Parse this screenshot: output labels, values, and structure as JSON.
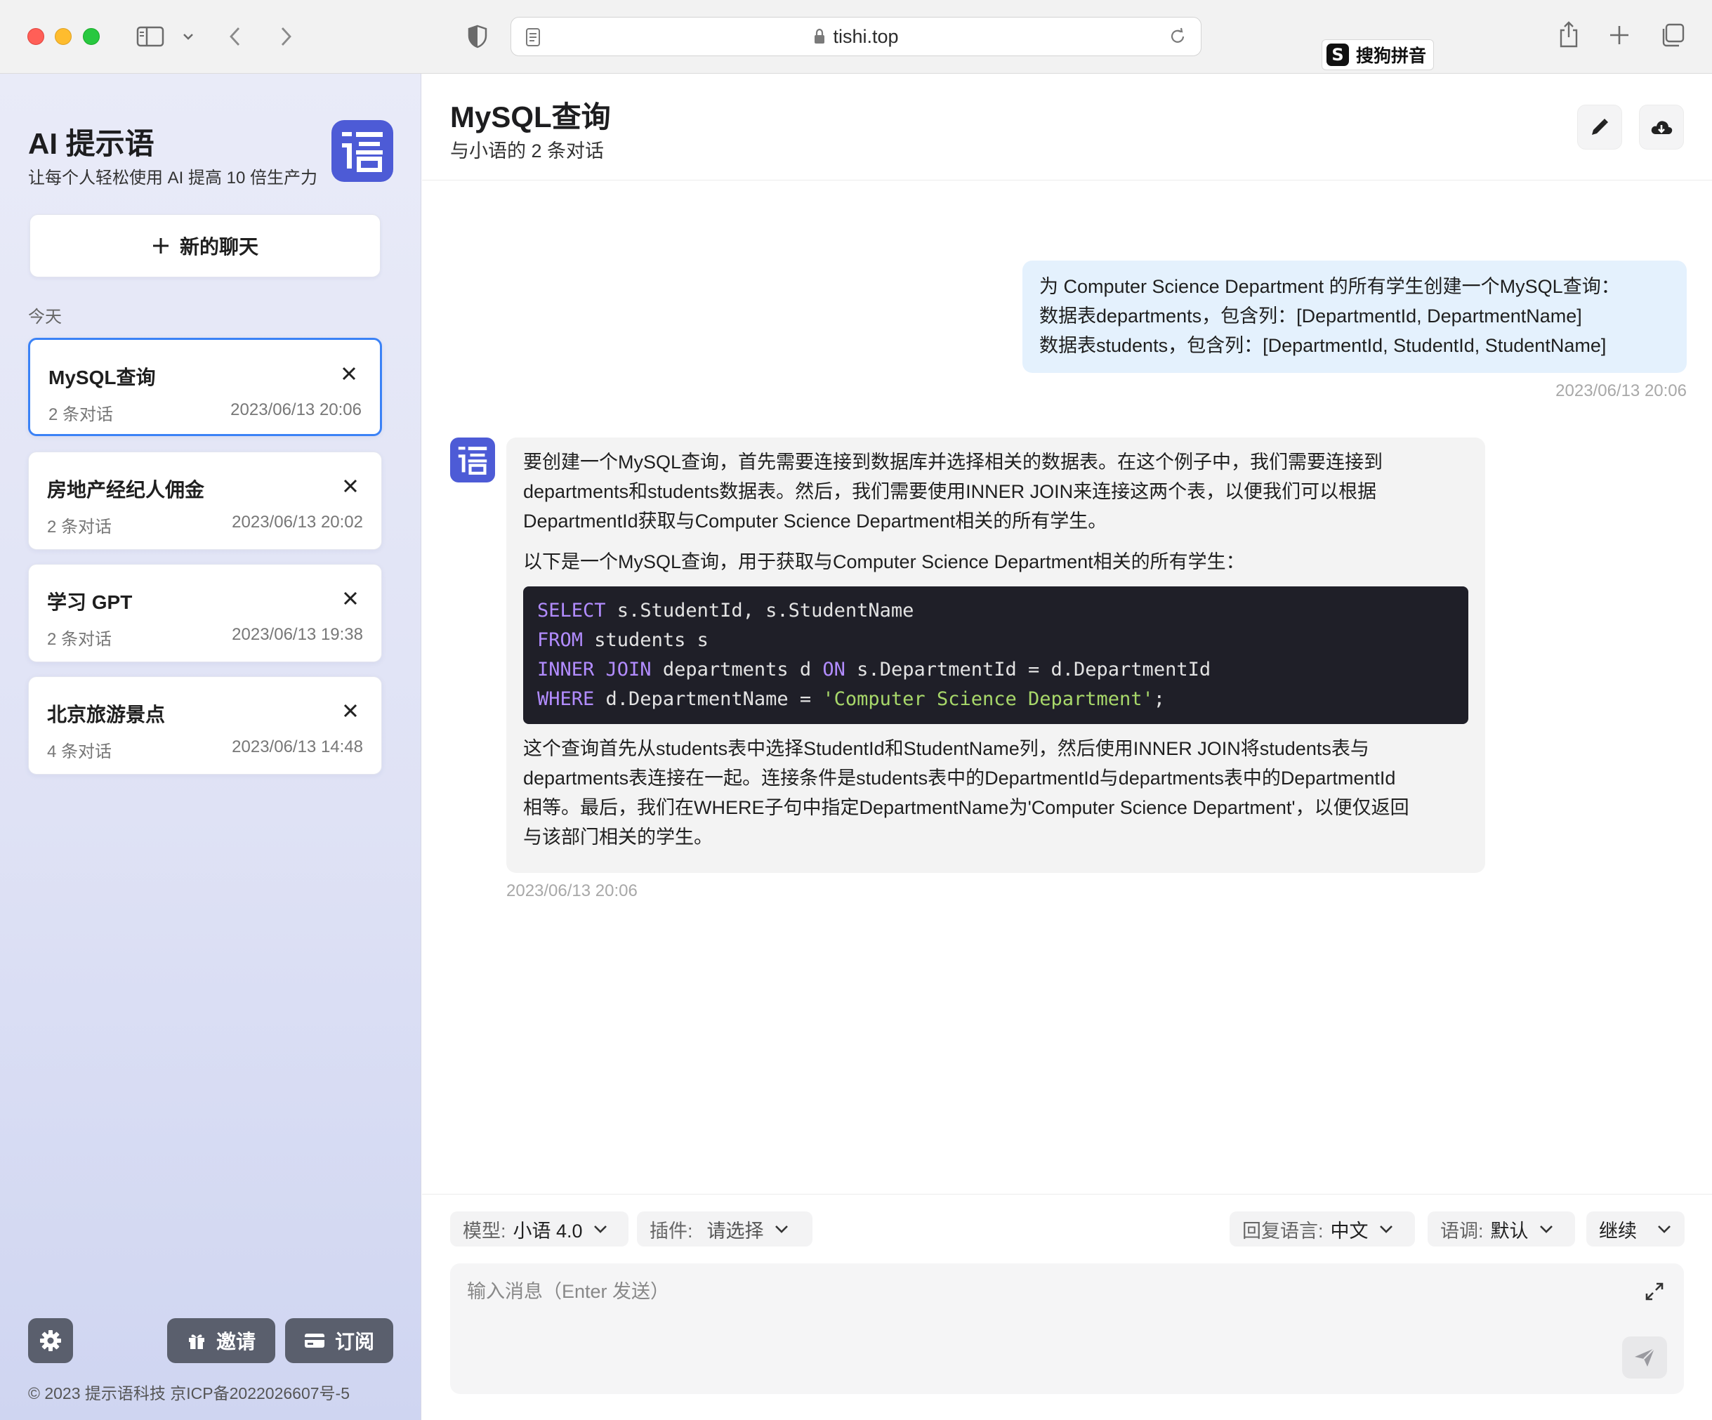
{
  "browser": {
    "url": "tishi.top",
    "ime_label": "搜狗拼音",
    "ime_logo_letter": "S"
  },
  "sidebar": {
    "brand_title": "AI 提示语",
    "brand_subtitle": "让每个人轻松使用 AI 提高 10 倍生产力",
    "logo_glyph": "语",
    "new_chat_label": "新的聊天",
    "section_label": "今天",
    "conversations": [
      {
        "title": "MySQL查询",
        "count": "2 条对话",
        "time": "2023/06/13 20:06",
        "active": true
      },
      {
        "title": "房地产经纪人佣金",
        "count": "2 条对话",
        "time": "2023/06/13 20:02",
        "active": false
      },
      {
        "title": "学习 GPT",
        "count": "2 条对话",
        "time": "2023/06/13 19:38",
        "active": false
      },
      {
        "title": "北京旅游景点",
        "count": "4 条对话",
        "time": "2023/06/13 14:48",
        "active": false
      }
    ],
    "invite_label": "邀请",
    "subscribe_label": "订阅",
    "footer": "© 2023 提示语科技   京ICP备2022026607号-5"
  },
  "main": {
    "title": "MySQL查询",
    "subtitle": "与小语的 2 条对话",
    "messages": {
      "user": {
        "lines": [
          "为 Computer Science Department 的所有学生创建一个MySQL查询：",
          "数据表departments，包含列：[DepartmentId, DepartmentName]",
          "数据表students，包含列：[DepartmentId, StudentId, StudentName]"
        ],
        "time": "2023/06/13 20:06"
      },
      "bot": {
        "intro_lines": [
          "要创建一个MySQL查询，首先需要连接到数据库并选择相关的数据表。在这个例子中，我们需要连接到",
          "departments和students数据表。然后，我们需要使用INNER JOIN来连接这两个表，以便我们可以根据",
          "DepartmentId获取与Computer Science Department相关的所有学生。"
        ],
        "lead": "以下是一个MySQL查询，用于获取与Computer Science Department相关的所有学生：",
        "code": {
          "l1_kw": "SELECT",
          "l1_rest": " s.StudentId, s.StudentName",
          "l2_kw": "FROM",
          "l2_rest": " students s",
          "l3_kw1": "INNER JOIN",
          "l3_mid": " departments d ",
          "l3_kw2": "ON",
          "l3_rest": " s.DepartmentId = d.DepartmentId",
          "l4_kw": "WHERE",
          "l4_mid": " d.DepartmentName = ",
          "l4_str": "'Computer Science Department'",
          "l4_end": ";"
        },
        "outro_lines": [
          "这个查询首先从students表中选择StudentId和StudentName列，然后使用INNER JOIN将students表与",
          "departments表连接在一起。连接条件是students表中的DepartmentId与departments表中的DepartmentId",
          "相等。最后，我们在WHERE子句中指定DepartmentName为'Computer Science Department'，以便仅返回",
          "与该部门相关的学生。"
        ],
        "time": "2023/06/13 20:06"
      }
    },
    "composer": {
      "model_label": "模型:",
      "model_value": "小语 4.0",
      "plugin_label": "插件:",
      "plugin_value": "请选择",
      "reply_lang_label": "回复语言:",
      "reply_lang_value": "中文",
      "tone_label": "语调:",
      "tone_value": "默认",
      "continue_label": "继续",
      "input_placeholder": "输入消息（Enter 发送）"
    }
  }
}
